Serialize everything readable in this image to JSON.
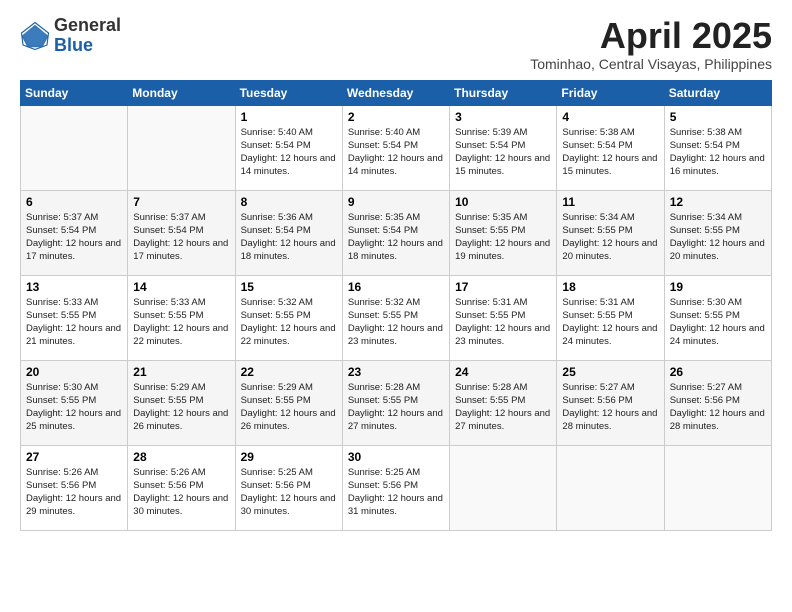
{
  "header": {
    "logo_general": "General",
    "logo_blue": "Blue",
    "month_title": "April 2025",
    "subtitle": "Tominhao, Central Visayas, Philippines"
  },
  "days_of_week": [
    "Sunday",
    "Monday",
    "Tuesday",
    "Wednesday",
    "Thursday",
    "Friday",
    "Saturday"
  ],
  "weeks": [
    [
      {
        "day": "",
        "info": ""
      },
      {
        "day": "",
        "info": ""
      },
      {
        "day": "1",
        "info": "Sunrise: 5:40 AM\nSunset: 5:54 PM\nDaylight: 12 hours and 14 minutes."
      },
      {
        "day": "2",
        "info": "Sunrise: 5:40 AM\nSunset: 5:54 PM\nDaylight: 12 hours and 14 minutes."
      },
      {
        "day": "3",
        "info": "Sunrise: 5:39 AM\nSunset: 5:54 PM\nDaylight: 12 hours and 15 minutes."
      },
      {
        "day": "4",
        "info": "Sunrise: 5:38 AM\nSunset: 5:54 PM\nDaylight: 12 hours and 15 minutes."
      },
      {
        "day": "5",
        "info": "Sunrise: 5:38 AM\nSunset: 5:54 PM\nDaylight: 12 hours and 16 minutes."
      }
    ],
    [
      {
        "day": "6",
        "info": "Sunrise: 5:37 AM\nSunset: 5:54 PM\nDaylight: 12 hours and 17 minutes."
      },
      {
        "day": "7",
        "info": "Sunrise: 5:37 AM\nSunset: 5:54 PM\nDaylight: 12 hours and 17 minutes."
      },
      {
        "day": "8",
        "info": "Sunrise: 5:36 AM\nSunset: 5:54 PM\nDaylight: 12 hours and 18 minutes."
      },
      {
        "day": "9",
        "info": "Sunrise: 5:35 AM\nSunset: 5:54 PM\nDaylight: 12 hours and 18 minutes."
      },
      {
        "day": "10",
        "info": "Sunrise: 5:35 AM\nSunset: 5:55 PM\nDaylight: 12 hours and 19 minutes."
      },
      {
        "day": "11",
        "info": "Sunrise: 5:34 AM\nSunset: 5:55 PM\nDaylight: 12 hours and 20 minutes."
      },
      {
        "day": "12",
        "info": "Sunrise: 5:34 AM\nSunset: 5:55 PM\nDaylight: 12 hours and 20 minutes."
      }
    ],
    [
      {
        "day": "13",
        "info": "Sunrise: 5:33 AM\nSunset: 5:55 PM\nDaylight: 12 hours and 21 minutes."
      },
      {
        "day": "14",
        "info": "Sunrise: 5:33 AM\nSunset: 5:55 PM\nDaylight: 12 hours and 22 minutes."
      },
      {
        "day": "15",
        "info": "Sunrise: 5:32 AM\nSunset: 5:55 PM\nDaylight: 12 hours and 22 minutes."
      },
      {
        "day": "16",
        "info": "Sunrise: 5:32 AM\nSunset: 5:55 PM\nDaylight: 12 hours and 23 minutes."
      },
      {
        "day": "17",
        "info": "Sunrise: 5:31 AM\nSunset: 5:55 PM\nDaylight: 12 hours and 23 minutes."
      },
      {
        "day": "18",
        "info": "Sunrise: 5:31 AM\nSunset: 5:55 PM\nDaylight: 12 hours and 24 minutes."
      },
      {
        "day": "19",
        "info": "Sunrise: 5:30 AM\nSunset: 5:55 PM\nDaylight: 12 hours and 24 minutes."
      }
    ],
    [
      {
        "day": "20",
        "info": "Sunrise: 5:30 AM\nSunset: 5:55 PM\nDaylight: 12 hours and 25 minutes."
      },
      {
        "day": "21",
        "info": "Sunrise: 5:29 AM\nSunset: 5:55 PM\nDaylight: 12 hours and 26 minutes."
      },
      {
        "day": "22",
        "info": "Sunrise: 5:29 AM\nSunset: 5:55 PM\nDaylight: 12 hours and 26 minutes."
      },
      {
        "day": "23",
        "info": "Sunrise: 5:28 AM\nSunset: 5:55 PM\nDaylight: 12 hours and 27 minutes."
      },
      {
        "day": "24",
        "info": "Sunrise: 5:28 AM\nSunset: 5:55 PM\nDaylight: 12 hours and 27 minutes."
      },
      {
        "day": "25",
        "info": "Sunrise: 5:27 AM\nSunset: 5:56 PM\nDaylight: 12 hours and 28 minutes."
      },
      {
        "day": "26",
        "info": "Sunrise: 5:27 AM\nSunset: 5:56 PM\nDaylight: 12 hours and 28 minutes."
      }
    ],
    [
      {
        "day": "27",
        "info": "Sunrise: 5:26 AM\nSunset: 5:56 PM\nDaylight: 12 hours and 29 minutes."
      },
      {
        "day": "28",
        "info": "Sunrise: 5:26 AM\nSunset: 5:56 PM\nDaylight: 12 hours and 30 minutes."
      },
      {
        "day": "29",
        "info": "Sunrise: 5:25 AM\nSunset: 5:56 PM\nDaylight: 12 hours and 30 minutes."
      },
      {
        "day": "30",
        "info": "Sunrise: 5:25 AM\nSunset: 5:56 PM\nDaylight: 12 hours and 31 minutes."
      },
      {
        "day": "",
        "info": ""
      },
      {
        "day": "",
        "info": ""
      },
      {
        "day": "",
        "info": ""
      }
    ]
  ]
}
